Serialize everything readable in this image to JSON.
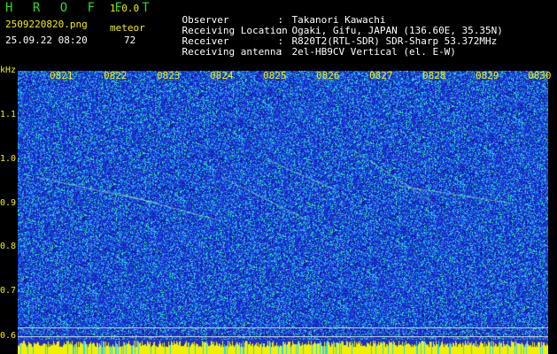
{
  "header": {
    "app_title": "H R O F F T",
    "app_version": "1.0.0",
    "filename": "2509220820.png",
    "datetime": "25.09.22 08:20",
    "mode_label": "meteor",
    "count": "72"
  },
  "info": [
    {
      "key": "Observer",
      "sep": ":",
      "value": "Takanori Kawachi"
    },
    {
      "key": "Receiving Location",
      "sep": ":",
      "value": "Ogaki, Gifu, JAPAN (136.60E, 35.35N)"
    },
    {
      "key": "Receiver",
      "sep": ":",
      "value": "R820T2(RTL-SDR) SDR-Sharp 53.372MHz"
    },
    {
      "key": "Receiving antenna",
      "sep": ":",
      "value": "2el-HB9CV Vertical (el. E-W)"
    }
  ],
  "time_ticks": [
    "0821",
    "0822",
    "0823",
    "0824",
    "0825",
    "0826",
    "0827",
    "0828",
    "0829",
    "0830"
  ],
  "freq_axis": {
    "unit_label": "kHz",
    "ticks": [
      "1.1",
      "1.0",
      "0.9",
      "0.8",
      "0.7",
      "0.6"
    ]
  },
  "colors": {
    "background": "#1a2fd0",
    "noise_light": "#28c0ff",
    "noise_bright": "#40ff90",
    "label": "#f0f000",
    "bottom_bar": "#f0f000"
  }
}
